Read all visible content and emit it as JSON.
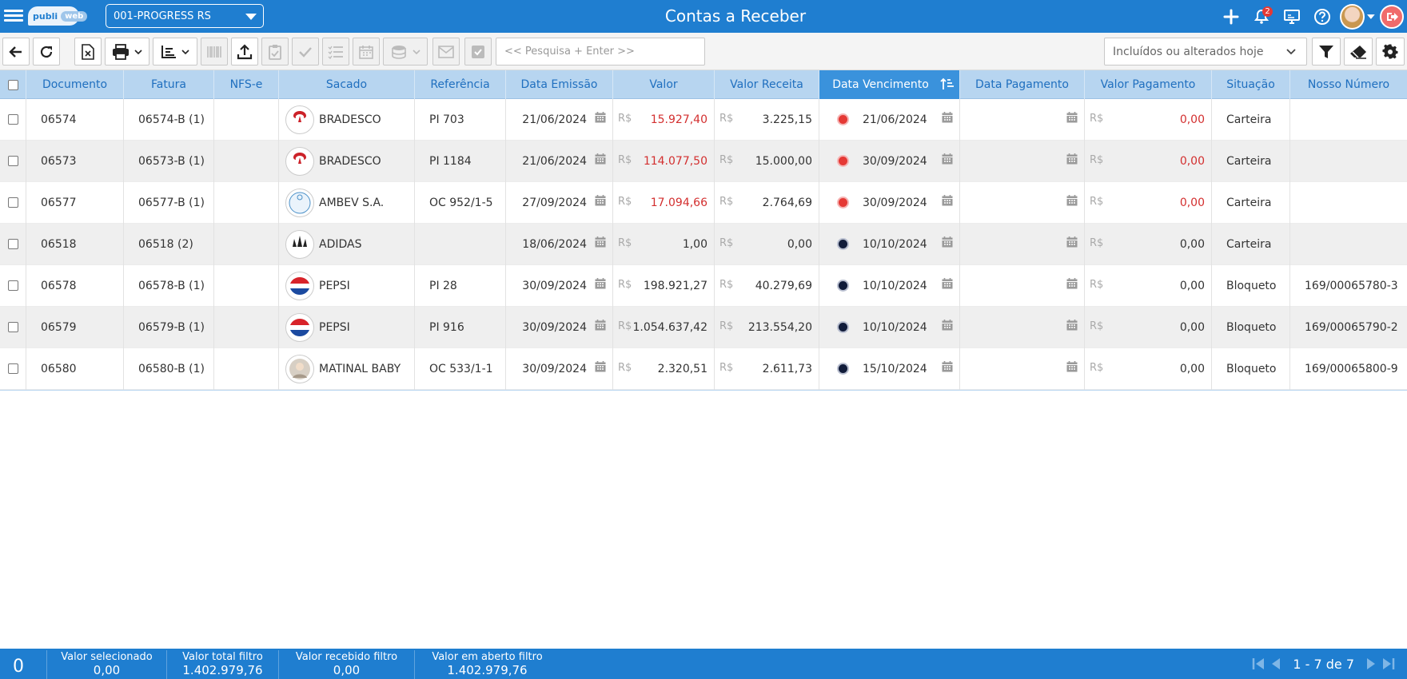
{
  "header": {
    "logo_left": "publi",
    "logo_right": "web",
    "company": "001-PROGRESS RS",
    "title": "Contas a Receber",
    "notifications_count": "2",
    "icons": [
      "plus-icon",
      "bell-icon",
      "monitor-icon",
      "help-icon",
      "avatar",
      "logout-icon"
    ]
  },
  "toolbar": {
    "search_placeholder": "<< Pesquisa + Enter >>",
    "filter_selected": "Incluídos ou alterados hoje",
    "icons": [
      "back-arrow-icon",
      "refresh-icon",
      "excel-icon",
      "print-icon",
      "report-icon",
      "barcode-icon",
      "upload-icon",
      "clipboard-icon",
      "check-icon",
      "list-icon",
      "calendar-icon",
      "coins-icon",
      "mail-icon",
      "checkbox-icon",
      "filter-icon",
      "eraser-icon",
      "gear-icon"
    ]
  },
  "columns": [
    "Documento",
    "Fatura",
    "NFS-e",
    "Sacado",
    "Referência",
    "Data Emissão",
    "Valor",
    "Valor Receita",
    "Data Vencimento",
    "Data Pagamento",
    "Valor Pagamento",
    "Situação",
    "Nosso Número"
  ],
  "sorted_column": "Data Vencimento",
  "currency": "R$",
  "rows": [
    {
      "documento": "06574",
      "fatura": "06574-B (1)",
      "nfse": "",
      "sacado": "BRADESCO",
      "logo": "bradesco",
      "referencia": "PI 703",
      "emissao": "21/06/2024",
      "valor": "15.927,40",
      "valor_red": true,
      "receita": "3.225,15",
      "status": "overdue",
      "vencimento": "21/06/2024",
      "pagamento": "",
      "valor_pagamento": "0,00",
      "vp_red": true,
      "situacao": "Carteira",
      "nosso_numero": ""
    },
    {
      "documento": "06573",
      "fatura": "06573-B (1)",
      "nfse": "",
      "sacado": "BRADESCO",
      "logo": "bradesco",
      "referencia": "PI 1184",
      "emissao": "21/06/2024",
      "valor": "114.077,50",
      "valor_red": true,
      "receita": "15.000,00",
      "status": "overdue",
      "vencimento": "30/09/2024",
      "pagamento": "",
      "valor_pagamento": "0,00",
      "vp_red": true,
      "situacao": "Carteira",
      "nosso_numero": ""
    },
    {
      "documento": "06577",
      "fatura": "06577-B (1)",
      "nfse": "",
      "sacado": "AMBEV S.A.",
      "logo": "ambev",
      "referencia": "OC 952/1-5",
      "emissao": "27/09/2024",
      "valor": "17.094,66",
      "valor_red": true,
      "receita": "2.764,69",
      "status": "overdue",
      "vencimento": "30/09/2024",
      "pagamento": "",
      "valor_pagamento": "0,00",
      "vp_red": true,
      "situacao": "Carteira",
      "nosso_numero": ""
    },
    {
      "documento": "06518",
      "fatura": "06518 (2)",
      "nfse": "",
      "sacado": "ADIDAS",
      "logo": "adidas",
      "referencia": "",
      "emissao": "18/06/2024",
      "valor": "1,00",
      "valor_red": false,
      "receita": "0,00",
      "status": "open",
      "vencimento": "10/10/2024",
      "pagamento": "",
      "valor_pagamento": "0,00",
      "vp_red": false,
      "situacao": "Carteira",
      "nosso_numero": ""
    },
    {
      "documento": "06578",
      "fatura": "06578-B (1)",
      "nfse": "",
      "sacado": "PEPSI",
      "logo": "pepsi",
      "referencia": "PI 28",
      "emissao": "30/09/2024",
      "valor": "198.921,27",
      "valor_red": false,
      "receita": "40.279,69",
      "status": "open",
      "vencimento": "10/10/2024",
      "pagamento": "",
      "valor_pagamento": "0,00",
      "vp_red": false,
      "situacao": "Bloqueto",
      "nosso_numero": "169/00065780-3"
    },
    {
      "documento": "06579",
      "fatura": "06579-B (1)",
      "nfse": "",
      "sacado": "PEPSI",
      "logo": "pepsi",
      "referencia": "PI 916",
      "emissao": "30/09/2024",
      "valor": "1.054.637,42",
      "valor_red": false,
      "receita": "213.554,20",
      "status": "open",
      "vencimento": "10/10/2024",
      "pagamento": "",
      "valor_pagamento": "0,00",
      "vp_red": false,
      "situacao": "Bloqueto",
      "nosso_numero": "169/00065790-2"
    },
    {
      "documento": "06580",
      "fatura": "06580-B (1)",
      "nfse": "",
      "sacado": "MATINAL BABY",
      "logo": "matinal",
      "referencia": "OC 533/1-1",
      "emissao": "30/09/2024",
      "valor": "2.320,51",
      "valor_red": false,
      "receita": "2.611,73",
      "status": "open",
      "vencimento": "15/10/2024",
      "pagamento": "",
      "valor_pagamento": "0,00",
      "vp_red": false,
      "situacao": "Bloqueto",
      "nosso_numero": "169/00065800-9"
    }
  ],
  "logo_text": {
    "bradesco": "rades",
    "ambev": "ama",
    "adidas": "adidas",
    "pepsi": "PEPS",
    "matinal": ""
  },
  "footer": {
    "selected_count": "0",
    "valor_selecionado_label": "Valor selecionado",
    "valor_selecionado": "0,00",
    "valor_total_label": "Valor total filtro",
    "valor_total": "1.402.979,76",
    "valor_recebido_label": "Valor recebido filtro",
    "valor_recebido": "0,00",
    "valor_aberto_label": "Valor em aberto filtro",
    "valor_aberto": "1.402.979,76",
    "pagination": "1 - 7 de 7"
  },
  "colors": {
    "primary": "#1f7ed0",
    "header_row": "#b7d5f0",
    "sorted_header": "#3a92dc",
    "overdue": "#e53935",
    "open": "#111c3a"
  }
}
